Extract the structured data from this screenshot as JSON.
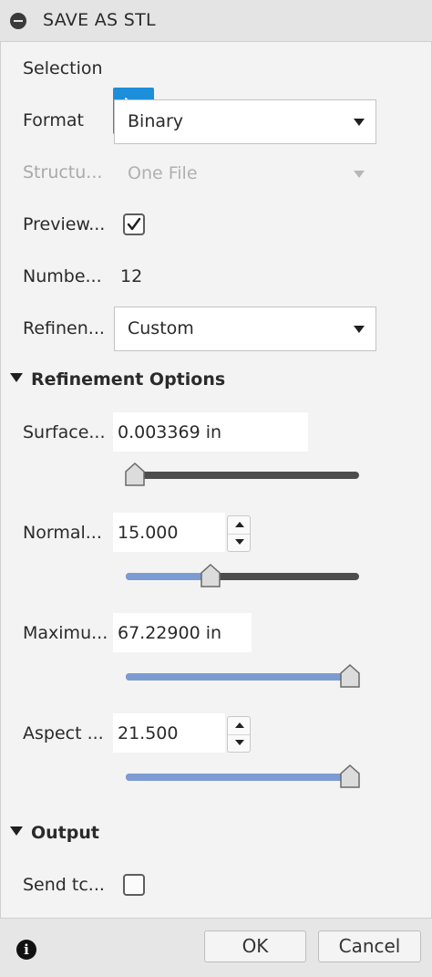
{
  "title_bar": {
    "title": "SAVE AS STL"
  },
  "form": {
    "selection_label": "Selection",
    "format_label": "Format",
    "format_value": "Binary",
    "structure_label": "Structu...",
    "structure_value": "One File",
    "preview_label": "Preview...",
    "preview_checked": true,
    "number_label": "Numbe...",
    "number_value": "12",
    "refinement_label": "Refinen...",
    "refinement_value": "Custom"
  },
  "refinement_options": {
    "header": "Refinement Options",
    "surface_label": "Surface...",
    "surface_value": "0.003369 in",
    "surface_slider_fraction": 0.0,
    "normal_label": "Normal...",
    "normal_value": "15.000",
    "normal_slider_fraction": 0.35,
    "maximum_label": "Maximu...",
    "maximum_value": "67.22900 in",
    "maximum_slider_fraction": 1.0,
    "aspect_label": "Aspect ...",
    "aspect_value": "21.500",
    "aspect_slider_fraction": 1.0
  },
  "output": {
    "header": "Output",
    "send_label": "Send tc...",
    "send_checked": false
  },
  "footer": {
    "ok_label": "OK",
    "cancel_label": "Cancel"
  },
  "colors": {
    "accent": "#1d8ed9",
    "slider_fill": "#7d9bd3",
    "slider_track": "#4d4d4d"
  }
}
